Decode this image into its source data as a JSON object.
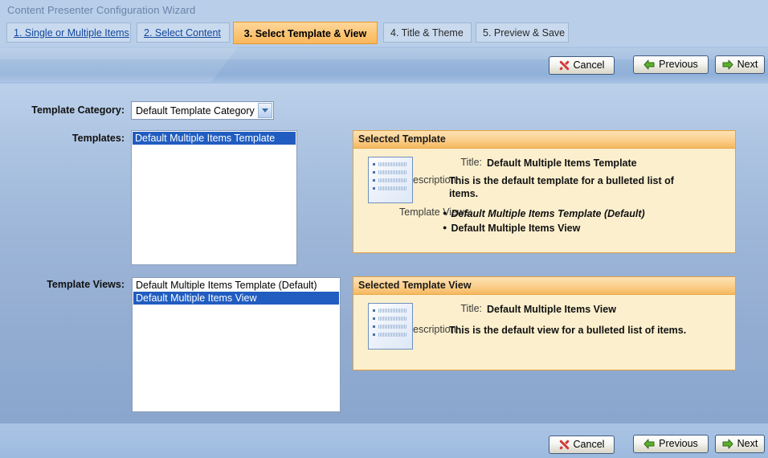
{
  "window": {
    "title": "Content Presenter Configuration Wizard"
  },
  "tabs": [
    {
      "label": "1. Single or Multiple Items",
      "active": false,
      "link": true
    },
    {
      "label": "2. Select Content",
      "active": false,
      "link": true
    },
    {
      "label": "3. Select Template & View",
      "active": true,
      "link": false
    },
    {
      "label": "4. Title & Theme",
      "active": false,
      "link": false
    },
    {
      "label": "5. Preview & Save",
      "active": false,
      "link": false
    }
  ],
  "toolbar": {
    "cancel_label": "Cancel",
    "previous_label": "Previous",
    "next_label": "Next",
    "cancel_icon": "cancel-x-icon",
    "previous_icon": "arrow-left-icon",
    "next_icon": "arrow-right-icon"
  },
  "form": {
    "template_category_label": "Template Category:",
    "template_category_value": "Default Template Category",
    "template_category_options": [
      "Default Template Category"
    ],
    "templates_label": "Templates:",
    "templates_items": [
      {
        "label": "Default Multiple Items Template",
        "selected": true
      }
    ],
    "template_views_label": "Template Views:",
    "template_views_items": [
      {
        "label": "Default Multiple Items Template (Default)",
        "selected": false
      },
      {
        "label": "Default Multiple Items View",
        "selected": true
      }
    ]
  },
  "selected_template": {
    "panel_title": "Selected Template",
    "title_key": "Title:",
    "title_value": "Default Multiple Items Template",
    "description_key": "Description:",
    "description_value": "This is the default template for a bulleted list of items.",
    "views_key": "Template Views:",
    "views": [
      {
        "label": "Default Multiple Items Template (Default)",
        "is_default": true
      },
      {
        "label": "Default Multiple Items View",
        "is_default": false
      }
    ],
    "thumbnail_icon": "bulleted-list-thumbnail-icon"
  },
  "selected_template_view": {
    "panel_title": "Selected Template View",
    "title_key": "Title:",
    "title_value": "Default Multiple Items View",
    "description_key": "Description:",
    "description_value": "This is the default view for a bulleted list of items.",
    "thumbnail_icon": "bulleted-list-thumbnail-icon"
  },
  "colors": {
    "page_background": "#b9cfe9",
    "active_tab": "#fbc474",
    "tab_link_text": "#14489c",
    "panel_header": "#f6b860",
    "panel_body": "#fbefcd",
    "panel_border": "#e6a33c",
    "list_selection": "#215dc0",
    "cancel_icon": "#d23b3b",
    "arrow_icon": "#5cb02c"
  }
}
